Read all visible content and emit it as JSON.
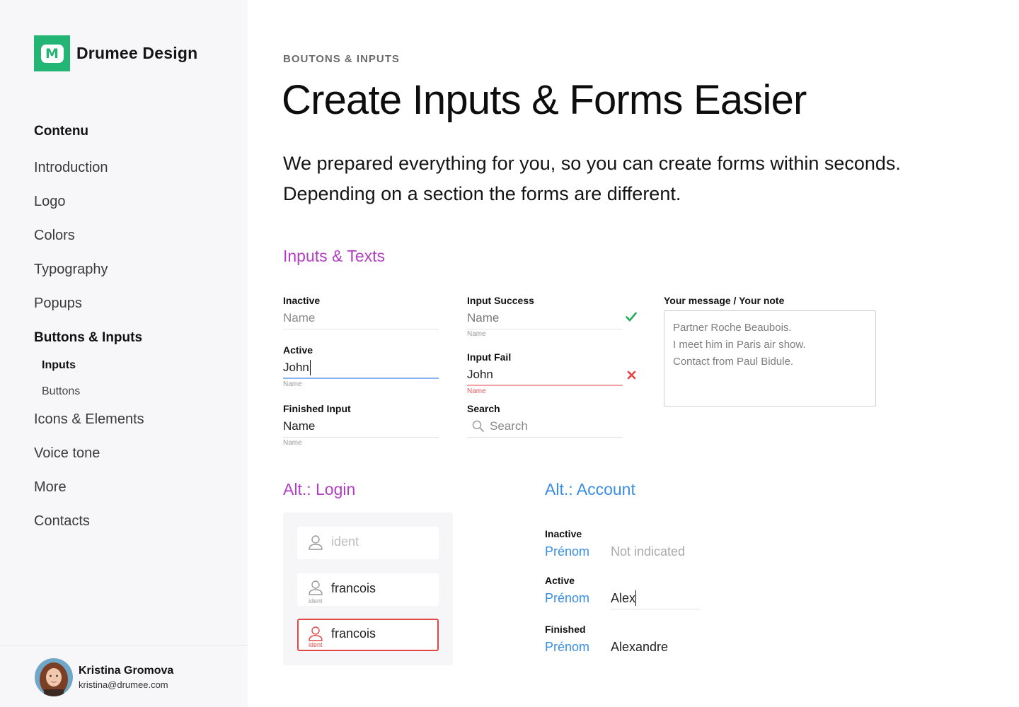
{
  "brand": {
    "name": "Drumee Design",
    "logo_letter": "M"
  },
  "nav": {
    "heading": "Contenu",
    "items": [
      {
        "label": "Introduction"
      },
      {
        "label": "Logo"
      },
      {
        "label": "Colors"
      },
      {
        "label": "Typography"
      },
      {
        "label": "Popups"
      },
      {
        "label": "Buttons & Inputs"
      },
      {
        "label": "Icons & Elements"
      },
      {
        "label": "Voice tone"
      },
      {
        "label": "More"
      },
      {
        "label": "Contacts"
      }
    ],
    "subitems": [
      {
        "label": "Inputs"
      },
      {
        "label": "Buttons"
      }
    ]
  },
  "user": {
    "name": "Kristina Gromova",
    "email": "kristina@drumee.com"
  },
  "header": {
    "eyebrow": "BOUTONS & INPUTS",
    "title": "Create Inputs & Forms Easier",
    "intro": "We prepared everything for you, so you can create forms within seconds. Depending on a section the forms are different."
  },
  "inputs_section": {
    "title": "Inputs & Texts",
    "inactive": {
      "label": "Inactive",
      "placeholder": "Name"
    },
    "active": {
      "label": "Active",
      "value": "John",
      "helper": "Name"
    },
    "finished": {
      "label": "Finished Input",
      "value": "Name",
      "helper": "Name"
    },
    "success": {
      "label": "Input Success",
      "value": "Name",
      "helper": "Name",
      "icon": "check-icon"
    },
    "fail": {
      "label": "Input Fail",
      "value": "John",
      "helper": "Name",
      "icon": "cross-icon"
    },
    "search": {
      "label": "Search",
      "placeholder": "Search",
      "icon": "search-icon"
    },
    "message": {
      "label": "Your message / Your note",
      "lines": [
        "Partner Roche Beaubois.",
        "I meet him in Paris air show.",
        "Contact from Paul Bidule."
      ]
    }
  },
  "login_section": {
    "title": "Alt.: Login",
    "fields": [
      {
        "value": "ident",
        "tag": ""
      },
      {
        "value": "francois",
        "tag": "ident"
      },
      {
        "value": "francois",
        "tag": "ident"
      }
    ]
  },
  "account_section": {
    "title": "Alt.: Account",
    "rows": [
      {
        "label": "Inactive",
        "key": "Prénom",
        "value": "Not indicated"
      },
      {
        "label": "Active",
        "key": "Prénom",
        "value": "Alex"
      },
      {
        "label": "Finished",
        "key": "Prénom",
        "value": "Alexandre"
      }
    ]
  },
  "colors": {
    "brand": "#22b573",
    "purple": "#b23fc2",
    "blue": "#3a8ee6",
    "success": "#1fae5b",
    "error": "#e34646"
  }
}
